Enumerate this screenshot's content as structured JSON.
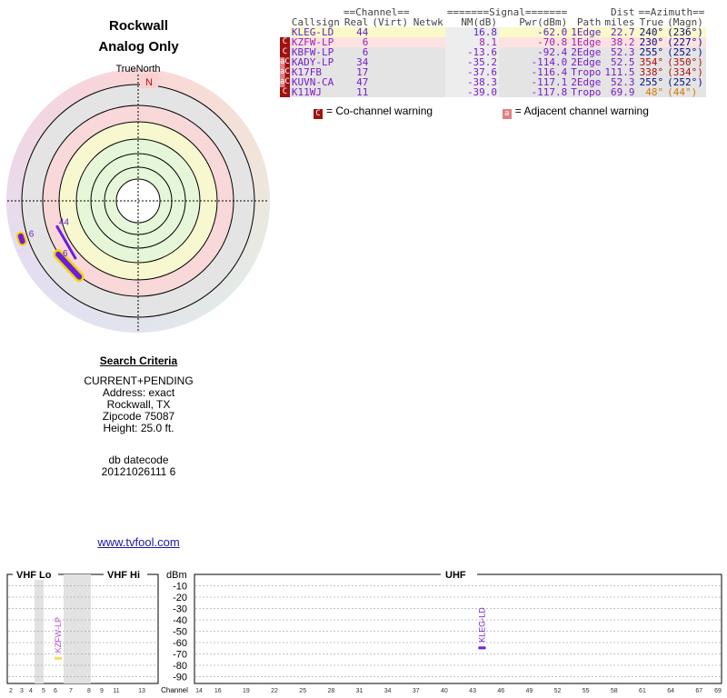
{
  "header": {
    "title": "Rockwall",
    "subtitle": "Analog Only"
  },
  "polar": {
    "true_north_label": "TrueNorth",
    "north_label": "N",
    "markers": [
      {
        "channel": "6",
        "azimuth": 252,
        "ring": 0.93,
        "width_deg": 8,
        "color": "#7a1cd6",
        "outline": "#f2d400"
      },
      {
        "channel": "44",
        "azimuth": 240,
        "ring": 0.63,
        "width_deg": 0,
        "color": "#6a1ee0",
        "outline": ""
      },
      {
        "channel": "6",
        "azimuth": 227,
        "ring": 0.72,
        "width_deg": 0,
        "color": "#6a1ee0",
        "outline": "#f2d400"
      }
    ]
  },
  "criteria": {
    "heading": "Search Criteria",
    "lines": [
      "CURRENT+PENDING",
      "Address: exact",
      "Rockwall, TX",
      "Zipcode 75087",
      "Height: 25.0 ft."
    ],
    "db_label": "db datecode",
    "db_value": "20121026111 6"
  },
  "link": "www.tvfool.com",
  "table": {
    "group_headers": {
      "channel": "==Channel==",
      "signal": "=======Signal=======",
      "dist": "Dist",
      "azimuth": "==Azimuth=="
    },
    "columns": [
      "Callsign",
      "Real",
      "(Virt)",
      "Netwk",
      "NM(dB)",
      "Pwr(dBm)",
      "Path",
      "miles",
      "True",
      "(Magn)"
    ],
    "rows": [
      {
        "warn": "",
        "callsign": "KLEG-LD",
        "real": "44",
        "virt": "",
        "netwk": "",
        "nm": "16.8",
        "pwr": "-62.0",
        "path": "1Edge",
        "miles": "22.7",
        "true": "240°",
        "magn": "(236°)",
        "bg": "#fafac8",
        "color": "#5b1fc8",
        "az_color": "#0b0b80"
      },
      {
        "warn": "C",
        "callsign": "KZFW-LP",
        "real": "6",
        "virt": "",
        "netwk": "",
        "nm": "8.1",
        "pwr": "-70.8",
        "path": "1Edge",
        "miles": "38.2",
        "true": "230°",
        "magn": "(227°)",
        "bg": "#fde2e2",
        "color": "#a01cb8",
        "az_color": "#0b0b80"
      },
      {
        "warn": "C",
        "callsign": "KBFW-LP",
        "real": "6",
        "virt": "",
        "netwk": "",
        "nm": "-13.6",
        "pwr": "-92.4",
        "path": "2Edge",
        "miles": "52.3",
        "true": "255°",
        "magn": "(252°)",
        "bg": "#e4e4e4",
        "color": "#7a1cc8",
        "az_color": "#0b0b80"
      },
      {
        "warn": "aC",
        "callsign": "KADY-LP",
        "real": "34",
        "virt": "",
        "netwk": "",
        "nm": "-35.2",
        "pwr": "-114.0",
        "path": "2Edge",
        "miles": "52.5",
        "true": "354°",
        "magn": "(350°)",
        "bg": "#e4e4e4",
        "color": "#7a1cc8",
        "az_color": "#b01010"
      },
      {
        "warn": "aC",
        "callsign": "K17FB",
        "real": "17",
        "virt": "",
        "netwk": "",
        "nm": "-37.6",
        "pwr": "-116.4",
        "path": "Tropo",
        "miles": "111.5",
        "true": "338°",
        "magn": "(334°)",
        "bg": "#e4e4e4",
        "color": "#7a1cc8",
        "az_color": "#b01010"
      },
      {
        "warn": "aC",
        "callsign": "KUVN-CA",
        "real": "47",
        "virt": "",
        "netwk": "",
        "nm": "-38.3",
        "pwr": "-117.1",
        "path": "2Edge",
        "miles": "52.3",
        "true": "255°",
        "magn": "(252°)",
        "bg": "#e4e4e4",
        "color": "#7a1cc8",
        "az_color": "#0b0b80"
      },
      {
        "warn": "C",
        "callsign": "K11WJ",
        "real": "11",
        "virt": "",
        "netwk": "",
        "nm": "-39.0",
        "pwr": "-117.8",
        "path": "Tropo",
        "miles": "69.9",
        "true": "48°",
        "magn": "(44°)",
        "bg": "#e4e4e4",
        "color": "#7a1cc8",
        "az_color": "#d07a00"
      }
    ]
  },
  "legend": {
    "co_mark": "C",
    "co_label": "= Co-channel warning",
    "adj_mark": "a",
    "adj_label": "= Adjacent channel warning"
  },
  "spectrum": {
    "vhf_lo_label": "VHF Lo",
    "vhf_hi_label": "VHF Hi",
    "uhf_label": "UHF",
    "dbm_label": "dBm",
    "dbm_ticks": [
      "-10",
      "-20",
      "-30",
      "-40",
      "-50",
      "-60",
      "-70",
      "-80",
      "-90"
    ],
    "channel_label": "Channel",
    "vhf_ticks": [
      "2",
      "3",
      "4",
      "5",
      "6",
      "7",
      "8",
      "9",
      "11",
      "13"
    ],
    "uhf_ticks": [
      "14",
      "16",
      "19",
      "22",
      "25",
      "28",
      "31",
      "34",
      "37",
      "40",
      "43",
      "46",
      "49",
      "52",
      "55",
      "58",
      "61",
      "64",
      "67",
      "69"
    ],
    "stations": [
      {
        "band": "vhf",
        "channel": 6,
        "dbm": -70.8,
        "label": "KZFW-LP",
        "color": "#b04ae0",
        "bar": "#f0e060"
      },
      {
        "band": "uhf",
        "channel": 44,
        "dbm": -62.0,
        "label": "KLEG-LD",
        "color": "#6a1ee0",
        "bar": "#6a1ee0"
      }
    ]
  }
}
